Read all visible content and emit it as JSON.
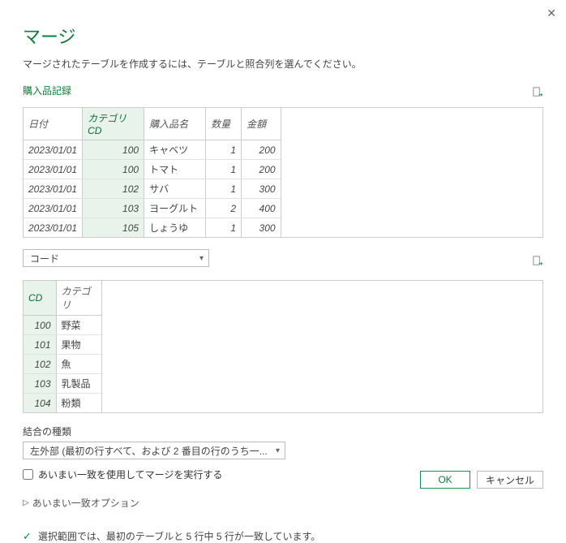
{
  "colors": {
    "accent": "#0e7c3a"
  },
  "dialog": {
    "title": "マージ",
    "subtitle": "マージされたテーブルを作成するには、テーブルと照合列を選んでください。"
  },
  "table1": {
    "name": "購入品記録",
    "headers": {
      "date": "日付",
      "catcd": "カテゴリCD",
      "item": "購入品名",
      "qty": "数量",
      "amt": "金額"
    },
    "rows": [
      {
        "date": "2023/01/01",
        "catcd": "100",
        "item": "キャベツ",
        "qty": "1",
        "amt": "200"
      },
      {
        "date": "2023/01/01",
        "catcd": "100",
        "item": "トマト",
        "qty": "1",
        "amt": "200"
      },
      {
        "date": "2023/01/01",
        "catcd": "102",
        "item": "サバ",
        "qty": "1",
        "amt": "300"
      },
      {
        "date": "2023/01/01",
        "catcd": "103",
        "item": "ヨーグルト",
        "qty": "2",
        "amt": "400"
      },
      {
        "date": "2023/01/01",
        "catcd": "105",
        "item": "しょうゆ",
        "qty": "1",
        "amt": "300"
      }
    ]
  },
  "table2": {
    "dropdown": "コード",
    "headers": {
      "cd": "CD",
      "cat": "カテゴリ"
    },
    "rows": [
      {
        "cd": "100",
        "cat": "野菜"
      },
      {
        "cd": "101",
        "cat": "果物"
      },
      {
        "cd": "102",
        "cat": "魚"
      },
      {
        "cd": "103",
        "cat": "乳製品"
      },
      {
        "cd": "104",
        "cat": "粉類"
      }
    ]
  },
  "join": {
    "label": "結合の種類",
    "value": "左外部 (最初の行すべて、および 2 番目の行のうち一...",
    "fuzzy_label": "あいまい一致を使用してマージを実行する",
    "fuzzy_checked": false,
    "options_label": "あいまい一致オプション"
  },
  "status": {
    "message": "選択範囲では、最初のテーブルと 5 行中 5 行が一致しています。"
  },
  "footer": {
    "ok": "OK",
    "cancel": "キャンセル"
  }
}
